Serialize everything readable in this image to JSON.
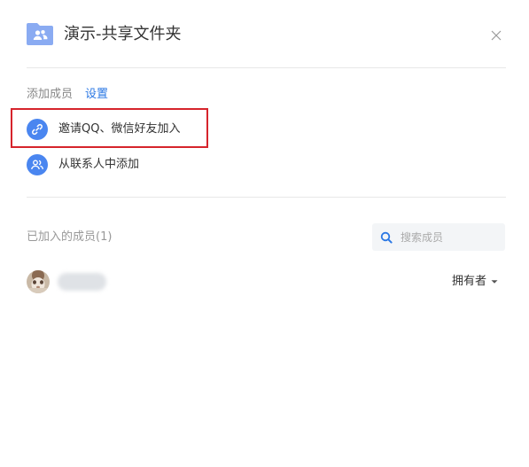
{
  "header": {
    "title": "演示-共享文件夹",
    "folder_icon": "shared-folder-icon",
    "close_icon": "close-icon"
  },
  "add_members": {
    "label": "添加成员",
    "settings_link": "设置",
    "options": [
      {
        "label": "邀请QQ、微信好友加入",
        "icon": "link-icon"
      },
      {
        "label": "从联系人中添加",
        "icon": "contacts-icon"
      }
    ]
  },
  "members": {
    "title": "已加入的成员(1)",
    "search_placeholder": "搜索成员",
    "list": [
      {
        "role": "拥有者",
        "avatar": "user-avatar"
      }
    ]
  },
  "colors": {
    "accent": "#2b78e4",
    "icon_bg": "#4a86f0",
    "folder": "#8aabf2",
    "highlight": "#d6242c"
  }
}
